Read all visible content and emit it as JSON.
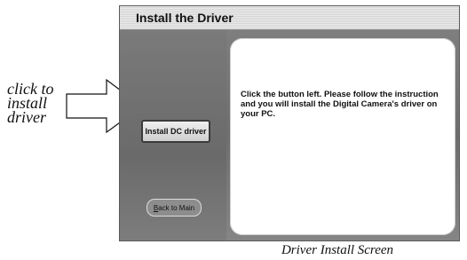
{
  "annotation": {
    "lines": [
      "click to",
      "install",
      "driver"
    ]
  },
  "window": {
    "title": "Install the Driver",
    "install_button_label": "Install DC driver",
    "back_button_label": "Back to Main",
    "back_button_mnemonic": "B",
    "back_button_rest": "ack to Main",
    "instruction_text": "Click the button left. Please follow the instruction and you will install the Digital Camera's driver on your PC."
  },
  "caption": "Driver Install Screen",
  "colors": {
    "window_bg": "#707070",
    "title_bar": "#dcdcdc",
    "content_bg": "#ffffff"
  },
  "icons": [
    "right-arrow-icon"
  ]
}
